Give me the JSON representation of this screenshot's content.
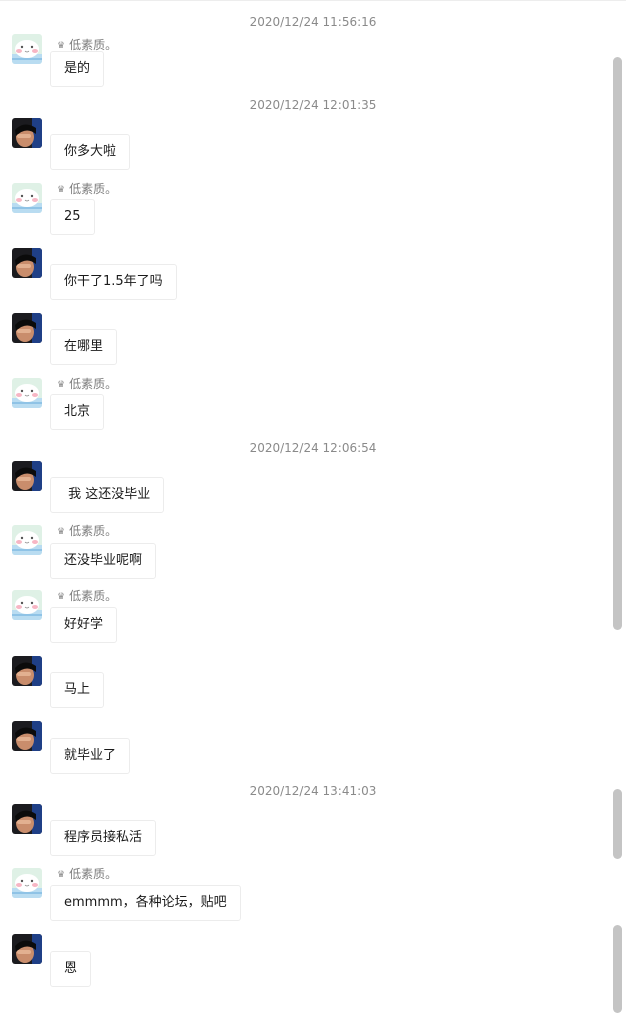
{
  "participants": {
    "self": {
      "nickname": "低素质。",
      "badge_icon": "crown-icon",
      "avatar": "pink-cartoon-avatar"
    },
    "other": {
      "avatar": "dark-photo-avatar"
    }
  },
  "timestamps": [
    "2020/12/24 11:56:16",
    "2020/12/24 12:01:35",
    "2020/12/24 12:06:54",
    "2020/12/24 13:41:03"
  ],
  "messages": [
    {
      "sender": "self",
      "text": "是的"
    },
    {
      "sender": "other",
      "text": "你多大啦"
    },
    {
      "sender": "self",
      "text": "25"
    },
    {
      "sender": "other",
      "text": "你干了1.5年了吗"
    },
    {
      "sender": "other",
      "text": "在哪里"
    },
    {
      "sender": "self",
      "text": "北京"
    },
    {
      "sender": "other",
      "text": " 我 这还没毕业"
    },
    {
      "sender": "self",
      "text": "还没毕业呢啊"
    },
    {
      "sender": "self",
      "text": "好好学"
    },
    {
      "sender": "other",
      "text": "马上"
    },
    {
      "sender": "other",
      "text": "就毕业了"
    },
    {
      "sender": "other",
      "text": "程序员接私活"
    },
    {
      "sender": "self",
      "text": "emmmm，各种论坛，贴吧"
    },
    {
      "sender": "other",
      "text": "恩"
    }
  ]
}
